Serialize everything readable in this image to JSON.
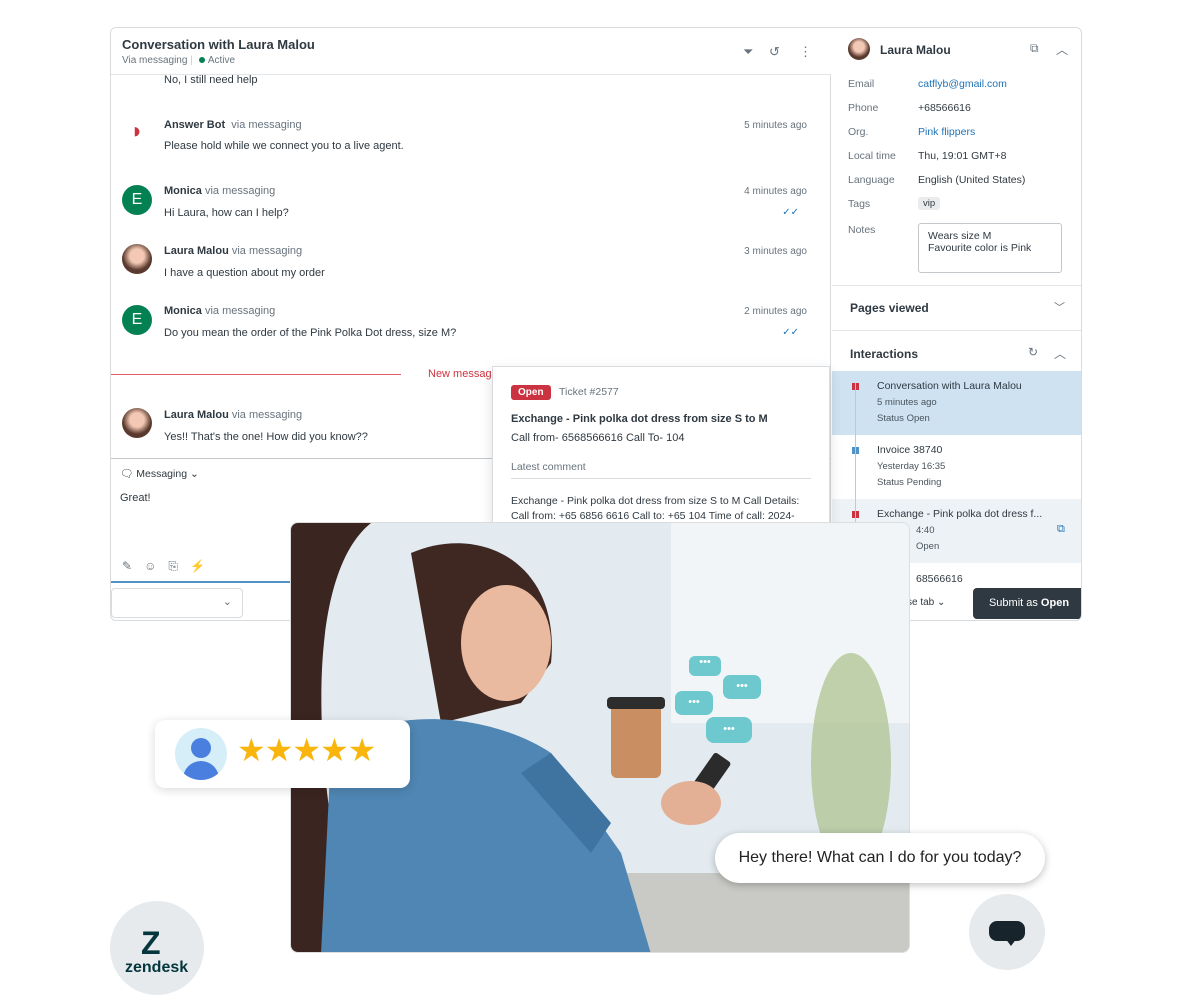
{
  "conversation": {
    "title": "Conversation with Laura Malou",
    "channel": "Via messaging",
    "status": "Active",
    "messages": [
      {
        "name": "",
        "via": "",
        "time": "",
        "text": "No, I still need help"
      },
      {
        "name": "Answer Bot",
        "via": "via messaging",
        "time": "5 minutes ago",
        "text": "Please hold while we connect you to a live agent."
      },
      {
        "name": "Monica",
        "via": "via messaging",
        "time": "4 minutes ago",
        "text": "Hi Laura, how can I help?",
        "avatar": "E"
      },
      {
        "name": "Laura Malou",
        "via": "via messaging",
        "time": "3 minutes ago",
        "text": "I have a question about my order"
      },
      {
        "name": "Monica",
        "via": "via messaging",
        "time": "2 minutes ago",
        "text": "Do you mean the order of the Pink Polka Dot dress, size M?",
        "avatar": "E"
      },
      {
        "name": "Laura Malou",
        "via": "via messaging",
        "time": "",
        "text": "Yes!! That's the one! How did you know??"
      }
    ],
    "new_messages": "New messages",
    "composer": {
      "channel": "Messaging",
      "value": "Great!"
    }
  },
  "ticket": {
    "badge": "Open",
    "number": "Ticket #2577",
    "subject": "Exchange - Pink polka dot dress from size S to M",
    "call": "Call from- 6568566616 Call To- 104",
    "latest_label": "Latest comment",
    "comment": "Exchange - Pink polka dot dress from size S to M Call Details: Call from: +65 6856 6616 Call to: +65 104 Time of call: 2024-"
  },
  "customer": {
    "name": "Laura Malou",
    "fields": [
      {
        "label": "Email",
        "value": "catflyb@gmail.com"
      },
      {
        "label": "Phone",
        "value": "+68566616"
      },
      {
        "label": "Org.",
        "value": "Pink flippers"
      },
      {
        "label": "Local time",
        "value": "Thu, 19:01 GMT+8"
      },
      {
        "label": "Language",
        "value": "English (United States)"
      },
      {
        "label": "Tags",
        "value": "vip"
      },
      {
        "label": "Notes",
        "value": "Wears size M\nFavourite color is Pink"
      }
    ]
  },
  "pages_viewed": "Pages viewed",
  "interactions": {
    "title": "Interactions",
    "items": [
      {
        "title": "Conversation with Laura Malou",
        "sub": "5 minutes ago",
        "status": "Status Open",
        "color": "#cc3340"
      },
      {
        "title": "Invoice 38740",
        "sub": "Yesterday 16:35",
        "status": "Status Pending",
        "color": "#5293c7"
      },
      {
        "title": "Exchange - Pink polka dot dress f...",
        "sub": "4:40",
        "status": "Open",
        "color": "#cc3340"
      }
    ],
    "phone_partial": "68566616"
  },
  "footer": {
    "close_tab": "Close tab",
    "submit": "Submit as ",
    "submit_status": "Open"
  },
  "rating": {
    "stars": 5
  },
  "chat_bubble": "Hey there! What can I do for you today?",
  "brand": "zendesk"
}
